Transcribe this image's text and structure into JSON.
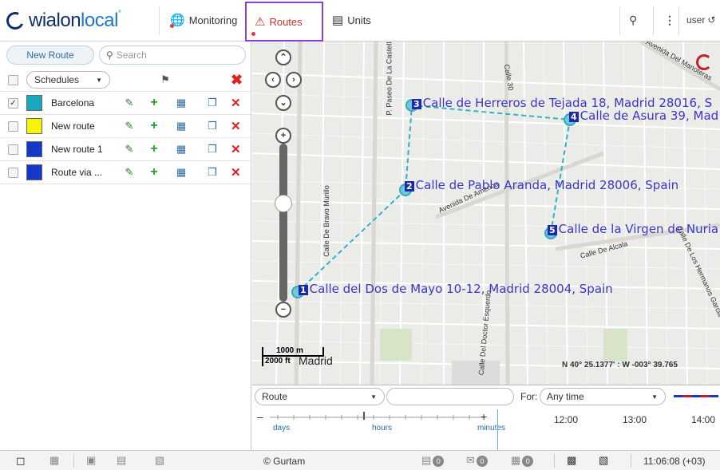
{
  "header": {
    "logo_main": "wialon",
    "logo_accent": "local",
    "tabs": {
      "monitoring": "Monitoring",
      "routes": "Routes",
      "units": "Units"
    },
    "user_label": "user"
  },
  "left_panel": {
    "new_route_label": "New Route",
    "search_placeholder": "Search",
    "schedules_label": "Schedules",
    "routes": [
      {
        "name": "Barcelona",
        "color": "#1aa7bf",
        "checked": true
      },
      {
        "name": "New route",
        "color": "#f5f500",
        "checked": false
      },
      {
        "name": "New route 1",
        "color": "#1438c8",
        "checked": false
      },
      {
        "name": "Route via ...",
        "color": "#1438c8",
        "checked": false
      }
    ]
  },
  "map": {
    "street_labels": [
      "Calle De Bravo Murillo",
      "P. Paseo De La Castellana",
      "Calle 30",
      "Avenida De America",
      "Calle De Alcala",
      "Calle Del Doctor Esquerdo",
      "Avenida Del Manoteras",
      "Calle De Los Hermanos Garcia Noblejas"
    ],
    "points": [
      {
        "num": "1",
        "label": "Calle del Dos de Mayo 10-12, Madrid 28004, Spain"
      },
      {
        "num": "2",
        "label": "Calle de Pablo Aranda, Madrid 28006, Spain"
      },
      {
        "num": "3",
        "label": "Calle de Herreros de Tejada 18, Madrid 28016, S"
      },
      {
        "num": "4",
        "label": "Calle de Asura 39, Mad"
      },
      {
        "num": "5",
        "label": "Calle de la Virgen de Nuria"
      }
    ],
    "scale_m": "1000 m",
    "scale_ft": "2000 ft",
    "city_label": "Madrid",
    "coordinates": "N 40° 25.1377' : W -003° 39.765"
  },
  "timeline": {
    "route_select": "Route",
    "for_label": "For:",
    "for_select": "Any time",
    "scale_labels": {
      "days": "days",
      "hours": "hours",
      "minutes": "minutes"
    },
    "times": [
      "12:00",
      "13:00",
      "14:00"
    ]
  },
  "bottom": {
    "copyright": "© Gurtam",
    "badges": [
      "0",
      "0",
      "0"
    ],
    "clock": "11:06:08 (+03)"
  }
}
